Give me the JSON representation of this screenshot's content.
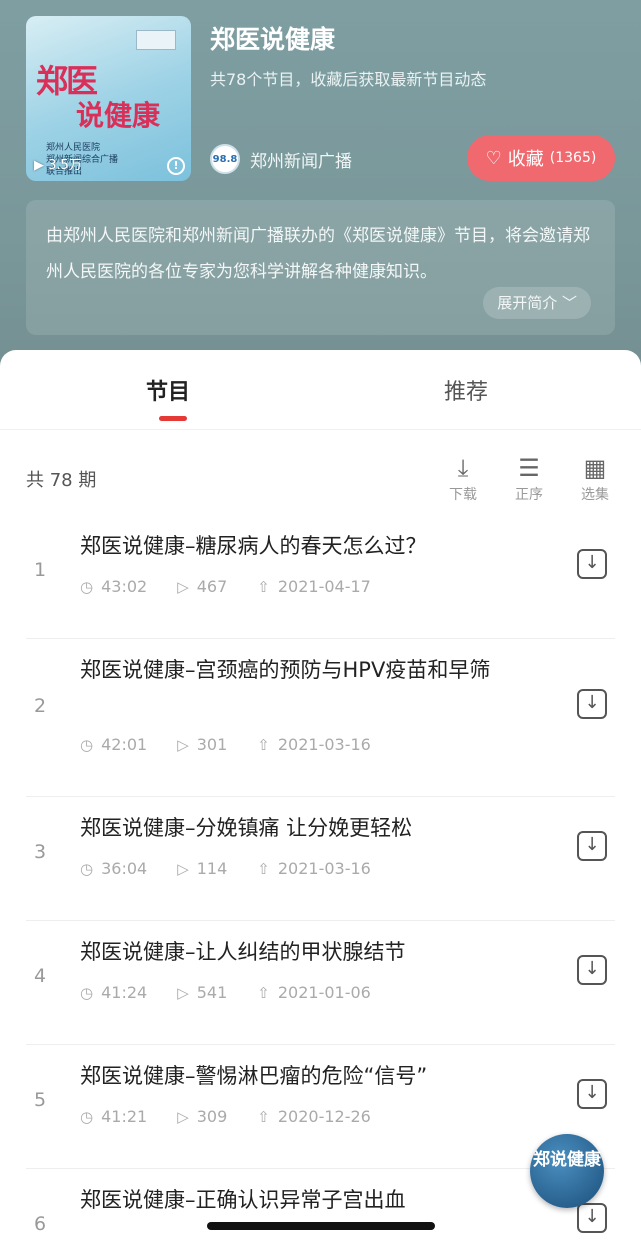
{
  "header": {
    "title": "郑医说健康",
    "subtitle": "共78个节目，收藏后获取最新节目动态",
    "cover": {
      "play_count": "3.5万",
      "line1": "郑医",
      "line2": "说健康",
      "org_lines": [
        "郑州人民医院",
        "郑州新闻综合广播",
        "联合推出"
      ]
    },
    "station": {
      "logo_text": "98.8",
      "name": "郑州新闻广播"
    },
    "favorite": {
      "label": "收藏",
      "count": "(1365)"
    },
    "description": "由郑州人民医院和郑州新闻广播联办的《郑医说健康》节目，将会邀请郑州人民医院的各位专家为您科学讲解各种健康知识。",
    "expand_label": "展开简介 ﹀"
  },
  "tabs": [
    {
      "label": "节目",
      "active": true
    },
    {
      "label": "推荐",
      "active": false
    }
  ],
  "toolbar": {
    "count_label": "共 78 期",
    "download_label": "下载",
    "order_label": "正序",
    "select_label": "选集"
  },
  "episodes": [
    {
      "index": "1",
      "title": "郑医说健康–糖尿病人的春天怎么过？",
      "duration": "43:02",
      "plays": "467",
      "date": "2021-04-17"
    },
    {
      "index": "2",
      "title": "郑医说健康–宫颈癌的预防与HPV疫苗和早筛",
      "duration": "42:01",
      "plays": "301",
      "date": "2021-03-16"
    },
    {
      "index": "3",
      "title": "郑医说健康–分娩镇痛 让分娩更轻松",
      "duration": "36:04",
      "plays": "114",
      "date": "2021-03-16"
    },
    {
      "index": "4",
      "title": "郑医说健康–让人纠结的甲状腺结节",
      "duration": "41:24",
      "plays": "541",
      "date": "2021-01-06"
    },
    {
      "index": "5",
      "title": "郑医说健康–警惕淋巴瘤的危险“信号”",
      "duration": "41:21",
      "plays": "309",
      "date": "2020-12-26"
    },
    {
      "index": "6",
      "title": "郑医说健康–正确认识异常子宫出血",
      "duration": "",
      "plays": "",
      "date": ""
    }
  ],
  "float_badge": {
    "text": "郑说健康"
  },
  "colors": {
    "accent": "#e53935",
    "favorite_bg": "#f0696f",
    "header_bg": "#7d9a9c"
  }
}
